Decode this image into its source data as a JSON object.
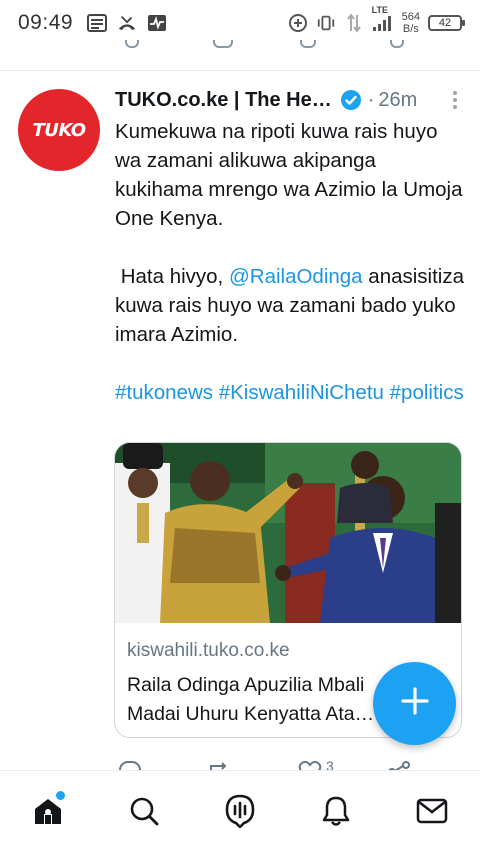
{
  "status_bar": {
    "time": "09:49",
    "network_type": "LTE",
    "net_speed_value": "564",
    "net_speed_unit": "B/s",
    "battery_level": "42",
    "icons": [
      "message-icon",
      "missed-call-icon",
      "activity-icon",
      "data-saver-icon",
      "vibrate-icon",
      "data-arrows-icon",
      "signal-icon",
      "battery-icon"
    ]
  },
  "tweet": {
    "author_name": "TUKO.co.ke | The He…",
    "avatar_text": "TUKO",
    "verified": true,
    "separator": "·",
    "time_ago": "26m",
    "text_line_1": "Kumekuwa na ripoti kuwa rais huyo wa zamani alikuwa akipanga kukihama mrengo wa Azimio la Umoja One Kenya.",
    "text_line_2_prefix": "Hata hivyo, ",
    "mention": "@RailaOdinga",
    "text_line_2_suffix": " anasisitiza kuwa rais huyo wa zamani bado yuko imara Azimio.",
    "hashtag_1": "#tukonews",
    "hashtag_2": "#KiswahiliNiChetu",
    "hashtag_3": "#politics",
    "like_count": "3",
    "card": {
      "domain": "kiswahili.tuko.co.ke",
      "title_line_1": "Raila Odinga Apuzilia Mbali",
      "title_line_2": "Madai Uhuru Kenyatta Ata…"
    }
  },
  "fab": {
    "icon": "plus-icon"
  },
  "bottom_nav": {
    "items": [
      "home-icon",
      "search-icon",
      "spaces-icon",
      "notifications-icon",
      "messages-icon"
    ]
  },
  "colors": {
    "accent": "#1da1f2",
    "link": "#1b95e0",
    "avatar_bg": "#e3262b",
    "muted_text": "#657786"
  }
}
